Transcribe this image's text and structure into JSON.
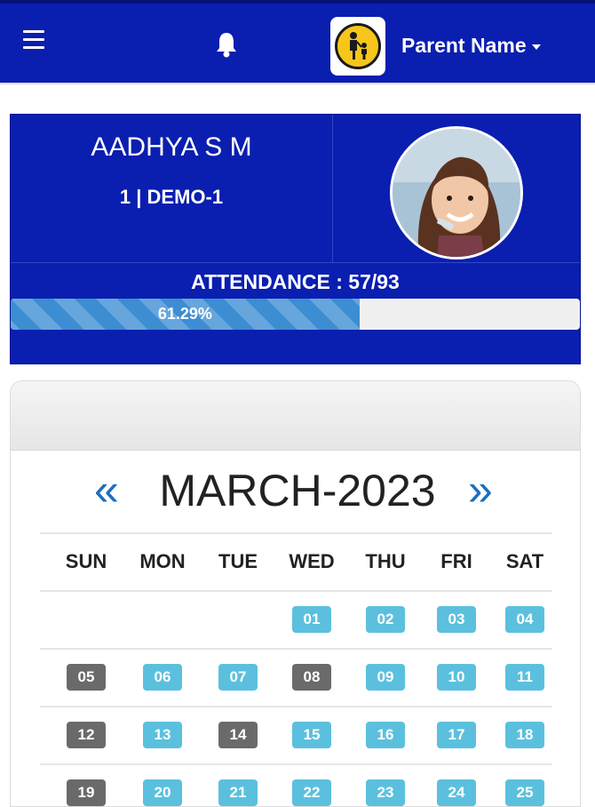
{
  "header": {
    "user_name": "Parent Name",
    "menu_icon": "hamburger-menu-icon",
    "notifications_icon": "bell-icon",
    "avatar_icon": "parent-child-icon",
    "color": "#0a1eb0"
  },
  "student": {
    "name": "AADHYA S M",
    "class_section": "1 | DEMO-1",
    "attendance_label": "ATTENDANCE : 57/93",
    "attendance_present": 57,
    "attendance_total": 93,
    "attendance_percent_label": "61.29%",
    "attendance_fraction": 0.6129
  },
  "calendar": {
    "month_label": "MARCH-2023",
    "prev_symbol": "«",
    "next_symbol": "»",
    "weekdays": [
      "SUN",
      "MON",
      "TUE",
      "WED",
      "THU",
      "FRI",
      "SAT"
    ],
    "colors": {
      "present": "#5bc0de",
      "holiday": "#6a6a6a"
    },
    "weeks": [
      [
        null,
        null,
        null,
        {
          "label": "01",
          "status": "present"
        },
        {
          "label": "02",
          "status": "present"
        },
        {
          "label": "03",
          "status": "present"
        },
        {
          "label": "04",
          "status": "present"
        }
      ],
      [
        {
          "label": "05",
          "status": "holiday"
        },
        {
          "label": "06",
          "status": "present"
        },
        {
          "label": "07",
          "status": "present"
        },
        {
          "label": "08",
          "status": "holiday"
        },
        {
          "label": "09",
          "status": "present"
        },
        {
          "label": "10",
          "status": "present"
        },
        {
          "label": "11",
          "status": "present"
        }
      ],
      [
        {
          "label": "12",
          "status": "holiday"
        },
        {
          "label": "13",
          "status": "present"
        },
        {
          "label": "14",
          "status": "holiday"
        },
        {
          "label": "15",
          "status": "present"
        },
        {
          "label": "16",
          "status": "present"
        },
        {
          "label": "17",
          "status": "present"
        },
        {
          "label": "18",
          "status": "present"
        }
      ],
      [
        {
          "label": "19",
          "status": "holiday"
        },
        {
          "label": "20",
          "status": "present"
        },
        {
          "label": "21",
          "status": "present"
        },
        {
          "label": "22",
          "status": "present"
        },
        {
          "label": "23",
          "status": "present"
        },
        {
          "label": "24",
          "status": "present"
        },
        {
          "label": "25",
          "status": "present"
        }
      ]
    ]
  }
}
